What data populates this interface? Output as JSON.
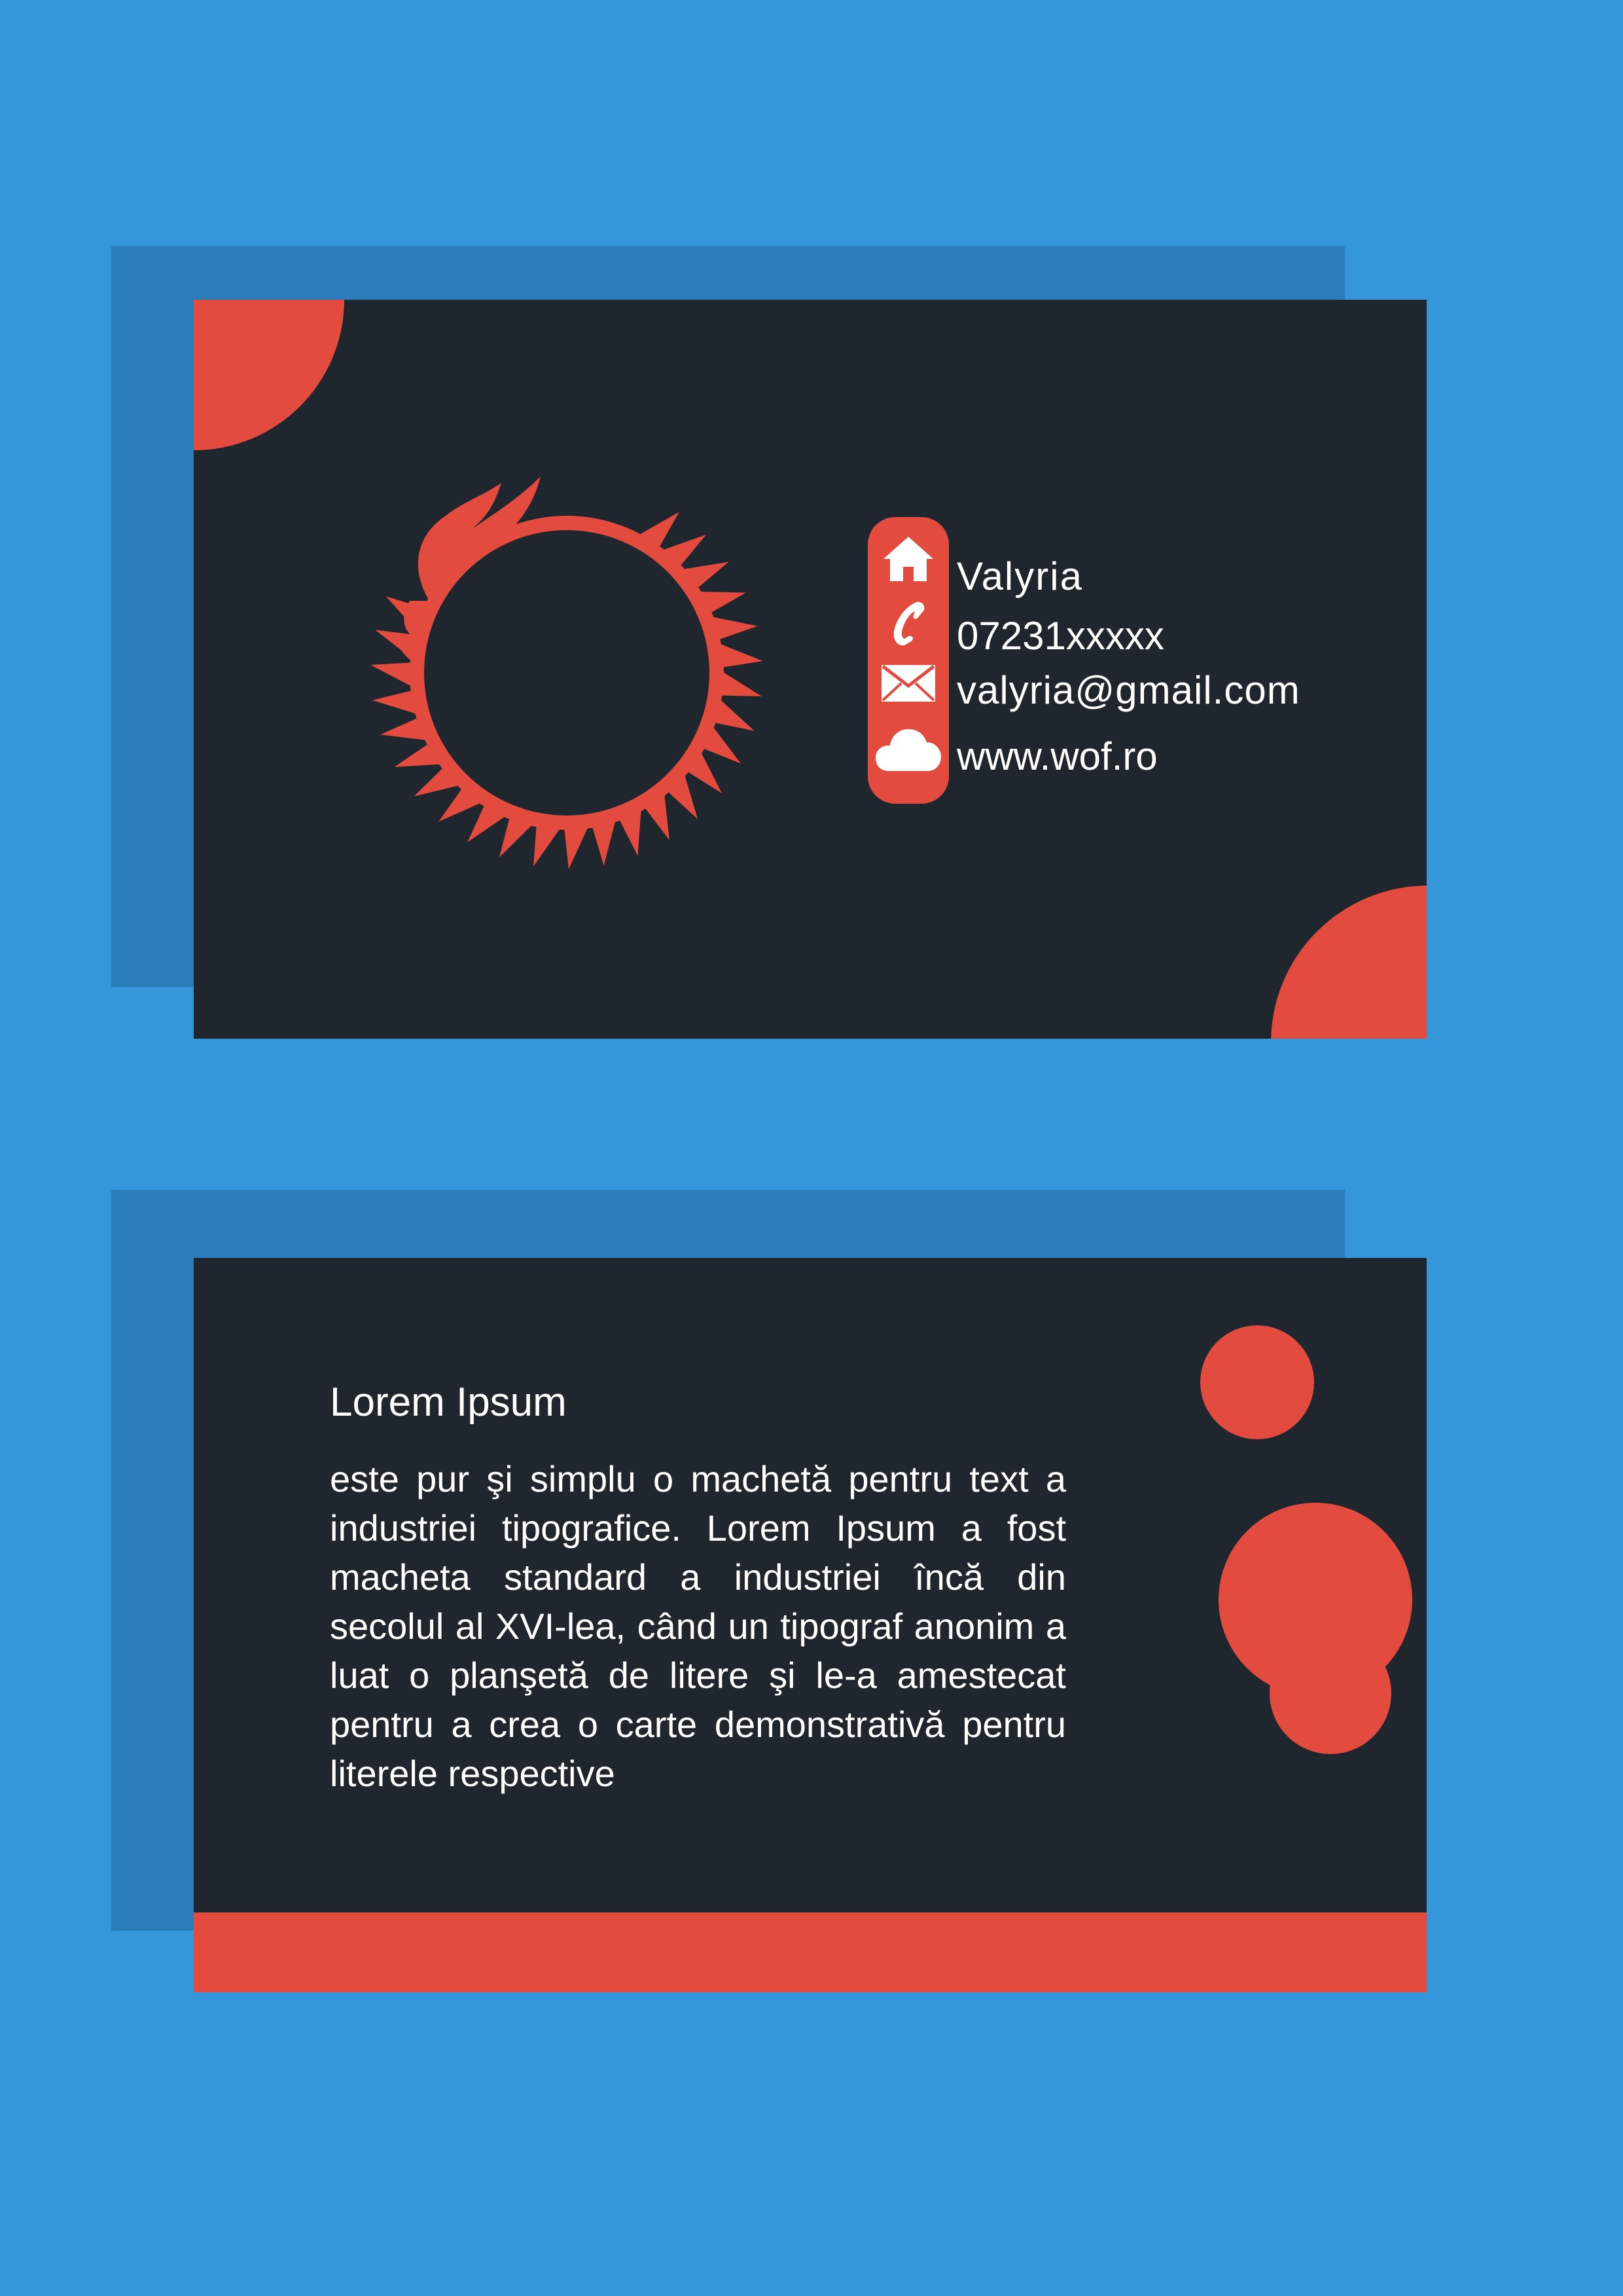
{
  "colors": {
    "page_background": "#3597da",
    "shadow_panel": "#2a7db8",
    "card_background": "#20262e",
    "accent": "#e24b3e",
    "text": "#ffffff"
  },
  "front_card": {
    "logo": "dragon-ouroboros-logo",
    "contacts": {
      "name": "Valyria",
      "phone": "07231xxxxx",
      "email": "valyria@gmail.com",
      "website": "www.wof.ro"
    },
    "icons": [
      "home-icon",
      "phone-icon",
      "mail-icon",
      "cloud-icon"
    ]
  },
  "back_card": {
    "title": "Lorem Ipsum",
    "body": "este pur şi simplu o machetă pentru text a industriei tipografice. Lorem Ipsum a fost macheta standard a industriei încă din secolul al XVI-lea, când un tipograf anonim a luat o planşetă de litere şi le-a amestecat pentru a crea o carte de­monstrativă pentru literele respective"
  }
}
